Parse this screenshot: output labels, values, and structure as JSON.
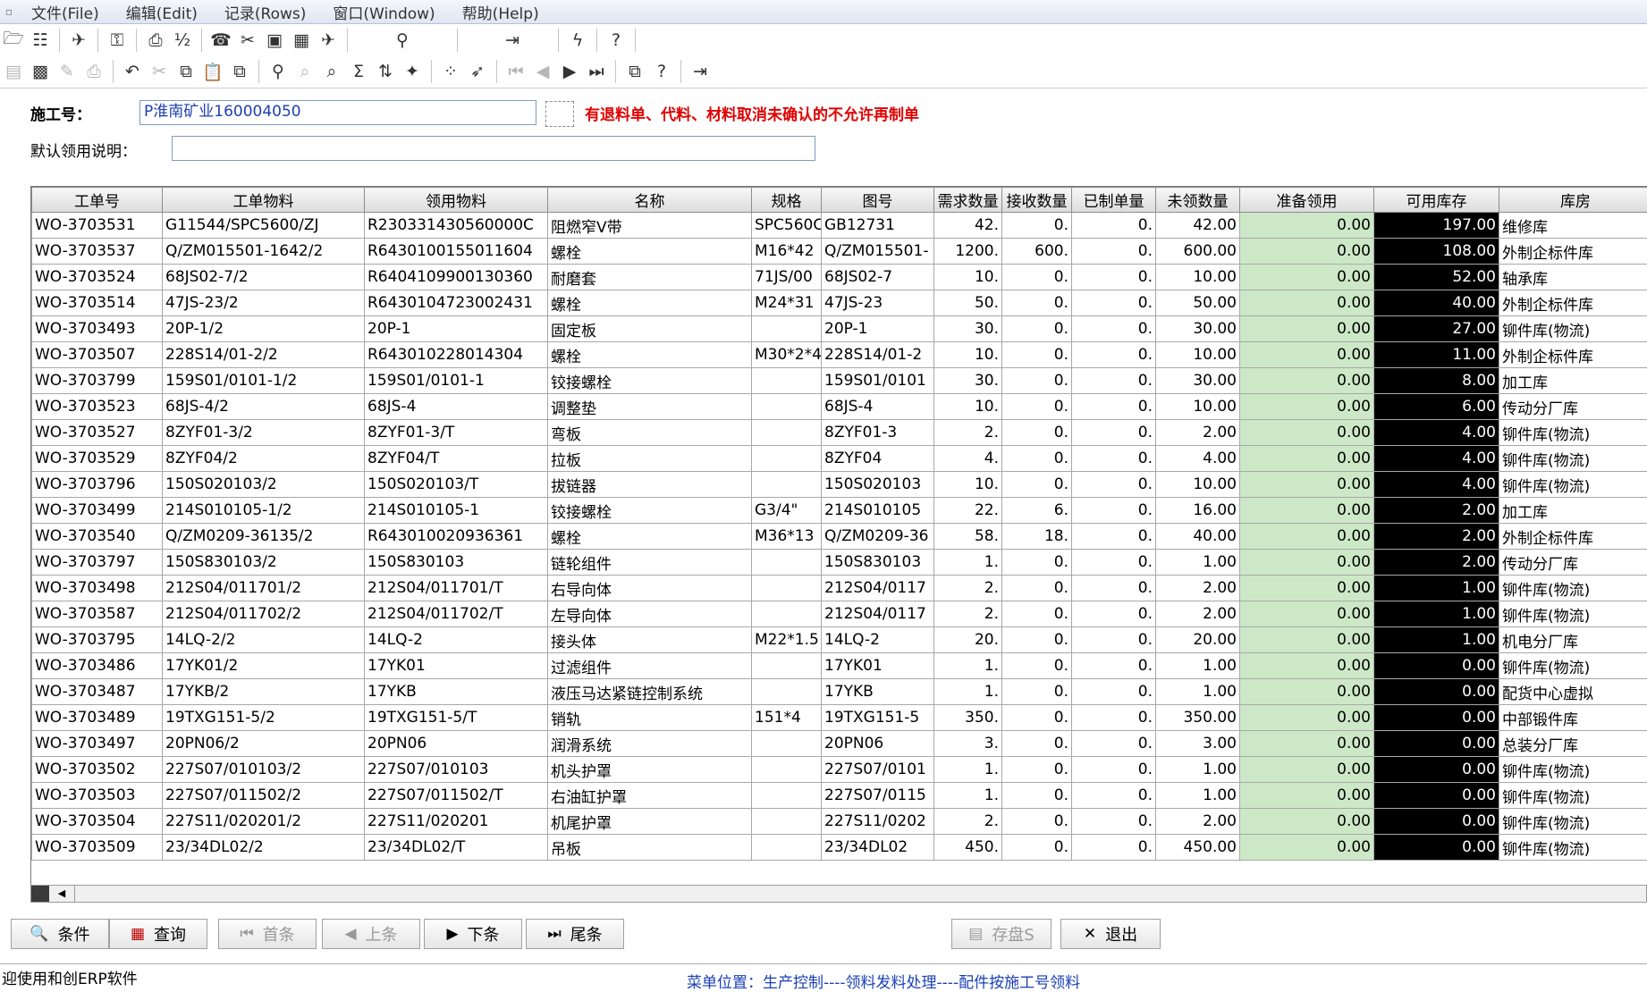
{
  "menu": [
    "文件(File)",
    "编辑(Edit)",
    "记录(Rows)",
    "窗口(Window)",
    "帮助(Help)"
  ],
  "form": {
    "construction_label": "施工号：",
    "construction_value": "P淮南矿业160004050",
    "warning": "有退料单、代料、材料取消未确认的不允许再制单",
    "note_label": "默认领用说明：",
    "note_value": ""
  },
  "table": {
    "headers": [
      "工单号",
      "工单物料",
      "领用物料",
      "名称",
      "规格",
      "图号",
      "需求数量",
      "接收数量",
      "已制单量",
      "未领数量",
      "准备领用",
      "可用库存",
      "库房"
    ],
    "rows": [
      [
        "WO-3703531",
        "G11544/SPC5600/ZJ",
        "R230331430560000C",
        "阻燃窄V带",
        "SPC560C",
        "GB12731",
        "42.",
        "0.",
        "0.",
        "42.00",
        "0.00",
        "197.00",
        "维修库"
      ],
      [
        "WO-3703537",
        "Q/ZM015501-1642/2",
        "R6430100155011604",
        "螺栓",
        "M16*42",
        "Q/ZM015501-",
        "1200.",
        "600.",
        "0.",
        "600.00",
        "0.00",
        "108.00",
        "外制企标件库"
      ],
      [
        "WO-3703524",
        "68JS02-7/2",
        "R6404109900130360",
        "耐磨套",
        "71JS/00",
        "68JS02-7",
        "10.",
        "0.",
        "0.",
        "10.00",
        "0.00",
        "52.00",
        "轴承库"
      ],
      [
        "WO-3703514",
        "47JS-23/2",
        "R6430104723002431",
        "螺栓",
        "M24*31",
        "47JS-23",
        "50.",
        "0.",
        "0.",
        "50.00",
        "0.00",
        "40.00",
        "外制企标件库"
      ],
      [
        "WO-3703493",
        "20P-1/2",
        "20P-1",
        "固定板",
        "",
        "20P-1",
        "30.",
        "0.",
        "0.",
        "30.00",
        "0.00",
        "27.00",
        "铆件库(物流)"
      ],
      [
        "WO-3703507",
        "228S14/01-2/2",
        "R643010228014304",
        "螺栓",
        "M30*2*4",
        "228S14/01-2",
        "10.",
        "0.",
        "0.",
        "10.00",
        "0.00",
        "11.00",
        "外制企标件库"
      ],
      [
        "WO-3703799",
        "159S01/0101-1/2",
        "159S01/0101-1",
        "铰接螺栓",
        "",
        "159S01/0101",
        "30.",
        "0.",
        "0.",
        "30.00",
        "0.00",
        "8.00",
        "加工库"
      ],
      [
        "WO-3703523",
        "68JS-4/2",
        "68JS-4",
        "调整垫",
        "",
        "68JS-4",
        "10.",
        "0.",
        "0.",
        "10.00",
        "0.00",
        "6.00",
        "传动分厂库"
      ],
      [
        "WO-3703527",
        "8ZYF01-3/2",
        "8ZYF01-3/T",
        "弯板",
        "",
        "8ZYF01-3",
        "2.",
        "0.",
        "0.",
        "2.00",
        "0.00",
        "4.00",
        "铆件库(物流)"
      ],
      [
        "WO-3703529",
        "8ZYF04/2",
        "8ZYF04/T",
        "拉板",
        "",
        "8ZYF04",
        "4.",
        "0.",
        "0.",
        "4.00",
        "0.00",
        "4.00",
        "铆件库(物流)"
      ],
      [
        "WO-3703796",
        "150S020103/2",
        "150S020103/T",
        "拔链器",
        "",
        "150S020103",
        "10.",
        "0.",
        "0.",
        "10.00",
        "0.00",
        "4.00",
        "铆件库(物流)"
      ],
      [
        "WO-3703499",
        "214S010105-1/2",
        "214S010105-1",
        "铰接螺栓",
        "G3/4\"",
        "214S010105",
        "22.",
        "6.",
        "0.",
        "16.00",
        "0.00",
        "2.00",
        "加工库"
      ],
      [
        "WO-3703540",
        "Q/ZM0209-36135/2",
        "R643010020936361",
        "螺栓",
        "M36*13",
        "Q/ZM0209-36",
        "58.",
        "18.",
        "0.",
        "40.00",
        "0.00",
        "2.00",
        "外制企标件库"
      ],
      [
        "WO-3703797",
        "150S830103/2",
        "150S830103",
        "链轮组件",
        "",
        "150S830103",
        "1.",
        "0.",
        "0.",
        "1.00",
        "0.00",
        "2.00",
        "传动分厂库"
      ],
      [
        "WO-3703498",
        "212S04/011701/2",
        "212S04/011701/T",
        "右导向体",
        "",
        "212S04/0117",
        "2.",
        "0.",
        "0.",
        "2.00",
        "0.00",
        "1.00",
        "铆件库(物流)"
      ],
      [
        "WO-3703587",
        "212S04/011702/2",
        "212S04/011702/T",
        "左导向体",
        "",
        "212S04/0117",
        "2.",
        "0.",
        "0.",
        "2.00",
        "0.00",
        "1.00",
        "铆件库(物流)"
      ],
      [
        "WO-3703795",
        "14LQ-2/2",
        "14LQ-2",
        "接头体",
        "M22*1.5",
        "14LQ-2",
        "20.",
        "0.",
        "0.",
        "20.00",
        "0.00",
        "1.00",
        "机电分厂库"
      ],
      [
        "WO-3703486",
        "17YK01/2",
        "17YK01",
        "过滤组件",
        "",
        "17YK01",
        "1.",
        "0.",
        "0.",
        "1.00",
        "0.00",
        "0.00",
        "铆件库(物流)"
      ],
      [
        "WO-3703487",
        "17YKB/2",
        "17YKB",
        "液压马达紧链控制系统",
        "",
        "17YKB",
        "1.",
        "0.",
        "0.",
        "1.00",
        "0.00",
        "0.00",
        "配货中心虚拟"
      ],
      [
        "WO-3703489",
        "19TXG151-5/2",
        "19TXG151-5/T",
        "销轨",
        "151*4",
        "19TXG151-5",
        "350.",
        "0.",
        "0.",
        "350.00",
        "0.00",
        "0.00",
        "中部锻件库"
      ],
      [
        "WO-3703497",
        "20PN06/2",
        "20PN06",
        "润滑系统",
        "",
        "20PN06",
        "3.",
        "0.",
        "0.",
        "3.00",
        "0.00",
        "0.00",
        "总装分厂库"
      ],
      [
        "WO-3703502",
        "227S07/010103/2",
        "227S07/010103",
        "机头护罩",
        "",
        "227S07/0101",
        "1.",
        "0.",
        "0.",
        "1.00",
        "0.00",
        "0.00",
        "铆件库(物流)"
      ],
      [
        "WO-3703503",
        "227S07/011502/2",
        "227S07/011502/T",
        "右油缸护罩",
        "",
        "227S07/0115",
        "1.",
        "0.",
        "0.",
        "1.00",
        "0.00",
        "0.00",
        "铆件库(物流)"
      ],
      [
        "WO-3703504",
        "227S11/020201/2",
        "227S11/020201",
        "机尾护罩",
        "",
        "227S11/0202",
        "2.",
        "0.",
        "0.",
        "2.00",
        "0.00",
        "0.00",
        "铆件库(物流)"
      ],
      [
        "WO-3703509",
        "23/34DL02/2",
        "23/34DL02/T",
        "吊板",
        "",
        "23/34DL02",
        "450.",
        "0.",
        "0.",
        "450.00",
        "0.00",
        "0.00",
        "铆件库(物流)"
      ]
    ]
  },
  "buttons": {
    "condition": "条件",
    "query": "查询",
    "first": "首条",
    "prev": "上条",
    "next": "下条",
    "last": "尾条",
    "save": "存盘S",
    "exit": "退出"
  },
  "status": {
    "left": "迎使用和创ERP软件",
    "menu_path": "菜单位置：生产控制----领料发料处理----配件按施工号领料"
  },
  "colors": {
    "ready_bg": "#cde8c6",
    "stock_bg": "#000000",
    "warning": "#e00000",
    "status_link": "#1a3fb8"
  }
}
